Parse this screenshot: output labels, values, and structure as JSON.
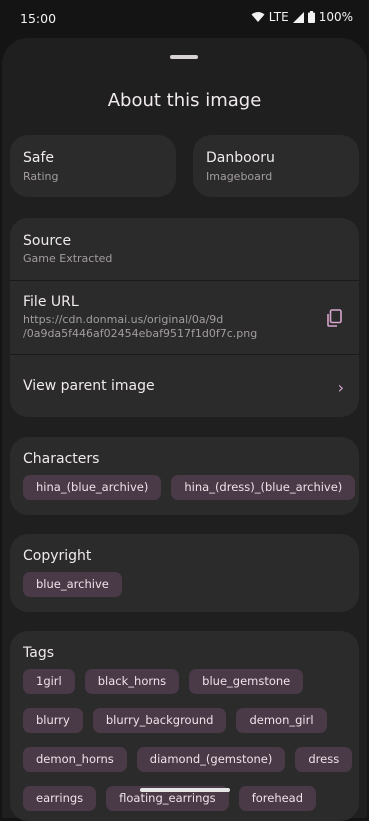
{
  "status": {
    "time": "15:00",
    "network": "LTE",
    "battery": "100%"
  },
  "sheet": {
    "title": "About this image"
  },
  "rating": {
    "value": "Safe",
    "label": "Rating"
  },
  "board": {
    "value": "Danbooru",
    "label": "Imageboard"
  },
  "source": {
    "label": "Source",
    "value": "Game Extracted"
  },
  "file_url": {
    "label": "File URL",
    "line1": "https://cdn.donmai.us/original/0a/9d",
    "line2": "/0a9da5f446af02454ebaf9517f1d0f7c.png"
  },
  "parent": {
    "label": "View parent image"
  },
  "characters": {
    "label": "Characters",
    "items": [
      "hina_(blue_archive)",
      "hina_(dress)_(blue_archive)"
    ]
  },
  "copyright": {
    "label": "Copyright",
    "items": [
      "blue_archive"
    ]
  },
  "tags": {
    "label": "Tags",
    "row1": [
      "1girl",
      "black_horns",
      "blue_gemstone"
    ],
    "row2": [
      "blurry",
      "blurry_background",
      "demon_girl"
    ],
    "row3": [
      "demon_horns",
      "diamond_(gemstone)",
      "dress"
    ],
    "row4": [
      "earrings",
      "floating_earrings",
      "forehead"
    ]
  },
  "colors": {
    "accent": "#d7a6cf",
    "chip": "#4a3946",
    "card": "#2b2b2b"
  }
}
